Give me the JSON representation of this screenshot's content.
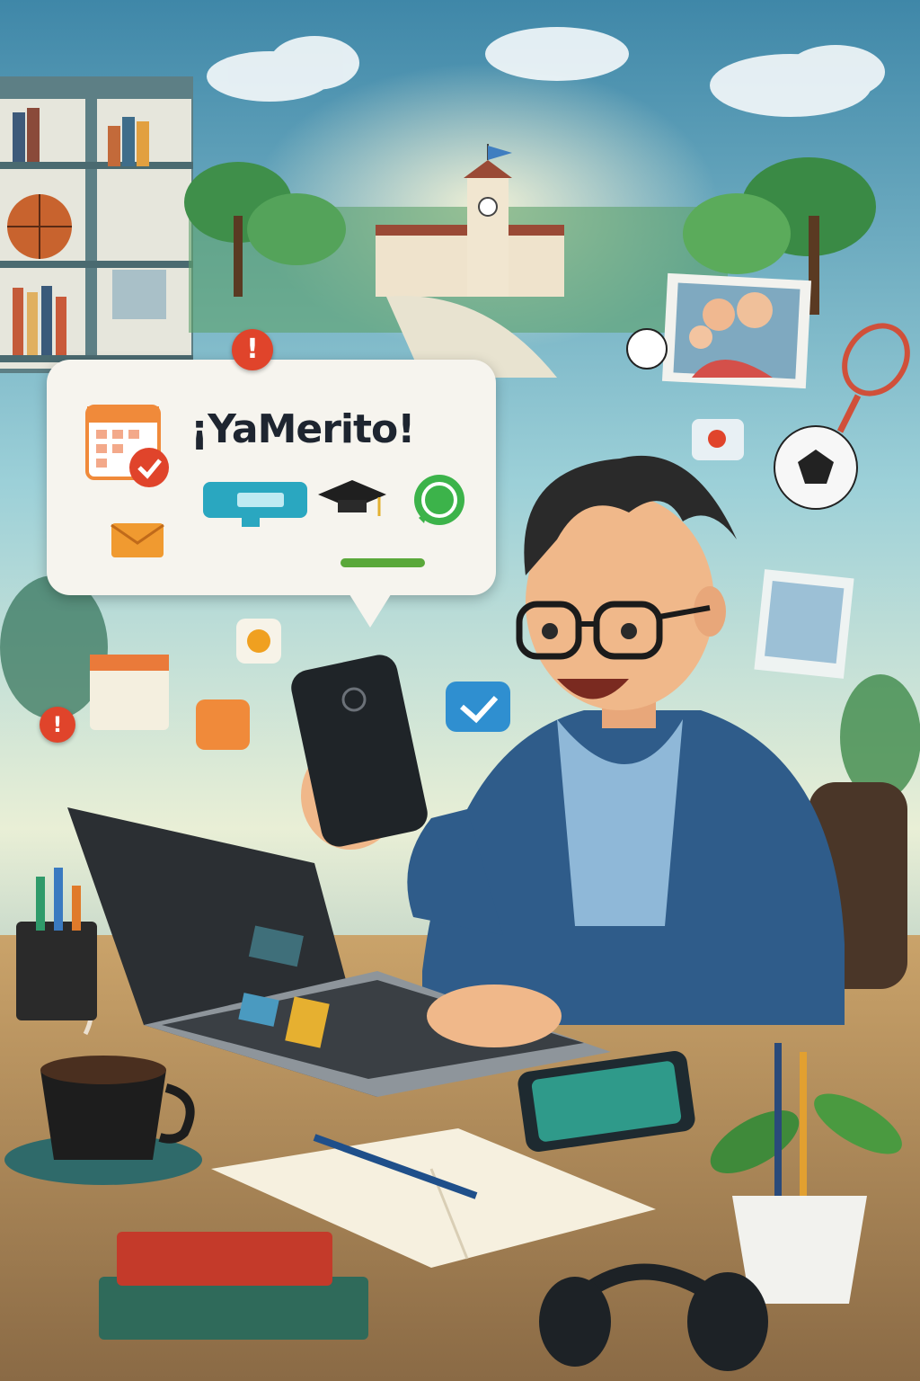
{
  "brand": {
    "name": "¡YaMerito!"
  },
  "icons": {
    "alert": "!",
    "calendar": "calendar-check-icon",
    "graduation": "graduation-cap-icon",
    "whatsapp": "whatsapp-icon",
    "email": "envelope-icon",
    "progress": "progress-bar-icon",
    "heart": "heart-icon",
    "chat": "chat-check-icon"
  },
  "colors": {
    "bubble": "#f6f4ee",
    "brand_text": "#1e2530",
    "alert_red": "#e0442b",
    "whatsapp_green": "#3cb34a",
    "calendar_orange": "#f08a3a",
    "hoodie_blue": "#2f5c8a",
    "sky": "#7fc0d8"
  }
}
